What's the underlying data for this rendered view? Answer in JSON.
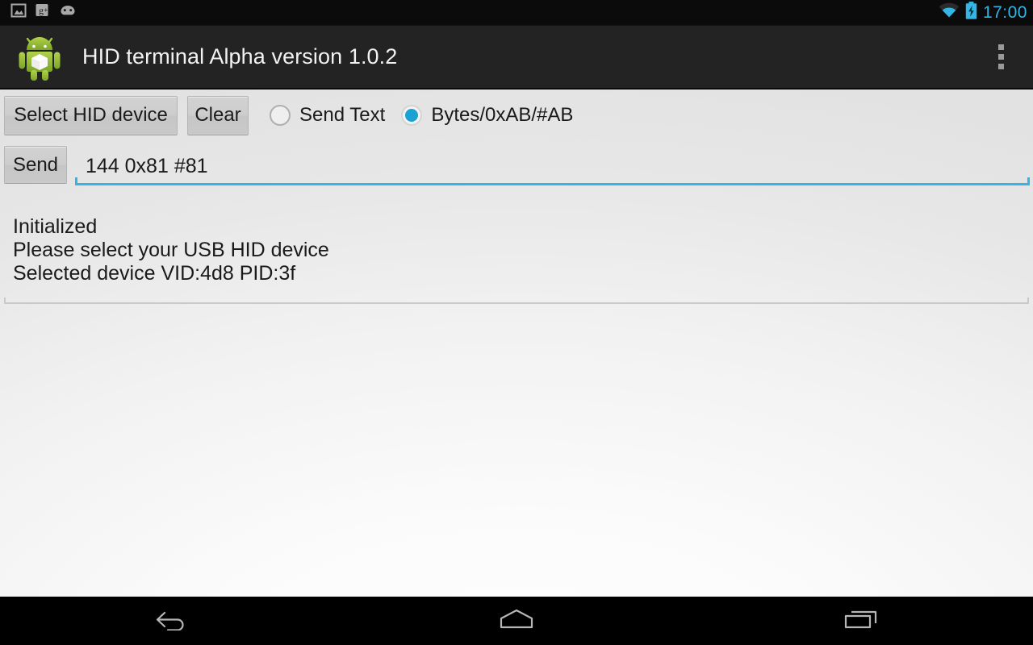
{
  "statusbar": {
    "notifications": [
      {
        "icon": "image-notification-icon"
      },
      {
        "icon": "google-plus-notification-icon"
      },
      {
        "icon": "android-notification-icon"
      }
    ],
    "wifi_icon": "wifi-icon",
    "battery_icon": "battery-charging-icon",
    "time": "17:00",
    "accent_color": "#33b5e5"
  },
  "actionbar": {
    "app_icon": "android-box-app-icon",
    "title": "HID terminal Alpha version 1.0.2",
    "overflow_icon": "overflow-menu-icon",
    "background_color": "#232323"
  },
  "controls": {
    "select_device_label": "Select HID device",
    "clear_label": "Clear",
    "send_label": "Send",
    "mode_options": [
      {
        "label": "Send Text",
        "selected": false
      },
      {
        "label": "Bytes/0xAB/#AB",
        "selected": true
      }
    ],
    "selected_mode": "Bytes/0xAB/#AB",
    "radio_selected_color": "#1ba1d2"
  },
  "send_input": {
    "value": "144 0x81 #81",
    "placeholder": "",
    "focus_underline_color": "#33b5e5"
  },
  "log": {
    "lines": [
      "Initialized",
      "Please select your USB HID device",
      "Selected device VID:4d8 PID:3f"
    ],
    "text": "Initialized\nPlease select your USB HID device\nSelected device VID:4d8 PID:3f"
  },
  "navbar": {
    "back_label": "Back",
    "home_label": "Home",
    "recents_label": "Recent apps",
    "icon_color": "#b6b6b6"
  }
}
